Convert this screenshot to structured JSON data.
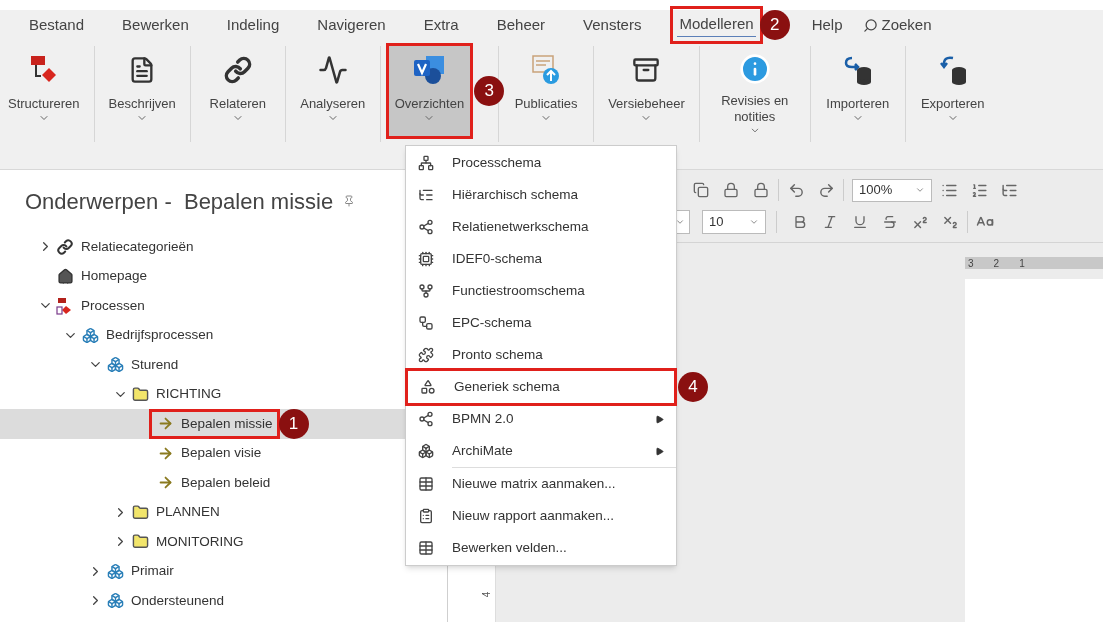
{
  "menu_bar": {
    "items": [
      {
        "label": "Bestand",
        "selected": false
      },
      {
        "label": "Bewerken",
        "selected": false
      },
      {
        "label": "Indeling",
        "selected": false
      },
      {
        "label": "Navigeren",
        "selected": false
      },
      {
        "label": "Extra",
        "selected": false
      },
      {
        "label": "Beheer",
        "selected": false
      },
      {
        "label": "Vensters",
        "selected": false
      },
      {
        "label": "Modelleren",
        "selected": true,
        "callout": "2"
      },
      {
        "label": "Help",
        "selected": false
      }
    ],
    "search": {
      "label": "Zoeken"
    }
  },
  "ribbon": {
    "buttons": [
      {
        "kind": "structure",
        "label": "Structureren",
        "selected": false
      },
      {
        "kind": "describe",
        "label": "Beschrijven",
        "selected": false
      },
      {
        "kind": "relate",
        "label": "Relateren",
        "selected": false
      },
      {
        "kind": "analyse",
        "label": "Analyseren",
        "selected": false
      },
      {
        "kind": "overview",
        "label": "Overzichten",
        "selected": true,
        "callout": "3"
      },
      {
        "kind": "publish",
        "label": "Publicaties",
        "selected": false
      },
      {
        "kind": "versions",
        "label": "Versiebeheer",
        "selected": false
      },
      {
        "kind": "revisions",
        "label": "Revisies en notities",
        "selected": false
      },
      {
        "kind": "import",
        "label": "Importeren",
        "selected": false
      },
      {
        "kind": "export",
        "label": "Exporteren",
        "selected": false
      }
    ]
  },
  "panel": {
    "title": "Onderwerpen -  Bepalen missie"
  },
  "tree": [
    {
      "kind": "category",
      "label": "Relatiecategorieën",
      "expanded": false,
      "selected": false
    },
    {
      "kind": "homepage",
      "label": "Homepage",
      "selected": false
    },
    {
      "kind": "processes",
      "label": "Processen",
      "expanded": true,
      "selected": false,
      "children": [
        {
          "kind": "process-group",
          "label": "Bedrijfsprocessen",
          "expanded": true,
          "selected": false,
          "children": [
            {
              "kind": "process-group",
              "label": "Sturend",
              "expanded": true,
              "selected": false,
              "children": [
                {
                  "kind": "folder",
                  "label": "RICHTING",
                  "expanded": true,
                  "selected": false,
                  "children": [
                    {
                      "kind": "process",
                      "label": "Bepalen missie",
                      "selected": true,
                      "callout": "1"
                    },
                    {
                      "kind": "process",
                      "label": "Bepalen visie",
                      "selected": false
                    },
                    {
                      "kind": "process",
                      "label": "Bepalen beleid",
                      "selected": false
                    }
                  ]
                },
                {
                  "kind": "folder",
                  "label": "PLANNEN",
                  "expanded": false,
                  "selected": false
                },
                {
                  "kind": "folder",
                  "label": "MONITORING",
                  "expanded": false,
                  "selected": false
                }
              ]
            },
            {
              "kind": "process-group",
              "label": "Primair",
              "expanded": false,
              "selected": false
            },
            {
              "kind": "process-group",
              "label": "Ondersteunend",
              "expanded": false,
              "selected": false
            }
          ]
        }
      ]
    }
  ],
  "dropdown": {
    "items": [
      {
        "kind": "process",
        "label": "Processchema",
        "submenu": false
      },
      {
        "kind": "hierarchy",
        "label": "Hiërarchisch schema",
        "submenu": false
      },
      {
        "kind": "network",
        "label": "Relatienetwerkschema",
        "submenu": false
      },
      {
        "kind": "idef0",
        "label": "IDEF0-schema",
        "submenu": false
      },
      {
        "kind": "function-flow",
        "label": "Functiestroomschema",
        "submenu": false
      },
      {
        "kind": "epc",
        "label": "EPC-schema",
        "submenu": false
      },
      {
        "kind": "pronto",
        "label": "Pronto schema",
        "submenu": false
      },
      {
        "kind": "generic",
        "label": "Generiek schema",
        "submenu": false,
        "callout": "4"
      },
      {
        "kind": "bpmn",
        "label": "BPMN 2.0",
        "submenu": true
      },
      {
        "kind": "archimate",
        "label": "ArchiMate",
        "submenu": true
      },
      {
        "kind": "matrix",
        "label": "Nieuwe matrix aanmaken...",
        "submenu": false,
        "separator_before": true
      },
      {
        "kind": "report",
        "label": "Nieuw rapport aanmaken...",
        "submenu": false
      },
      {
        "kind": "fields",
        "label": "Bewerken velden...",
        "submenu": false
      }
    ]
  },
  "editor": {
    "zoom": "100%",
    "font_size": "10",
    "ruler_horizontal": [
      "3",
      "2",
      "1"
    ],
    "ruler_vertical": [
      "4"
    ]
  }
}
